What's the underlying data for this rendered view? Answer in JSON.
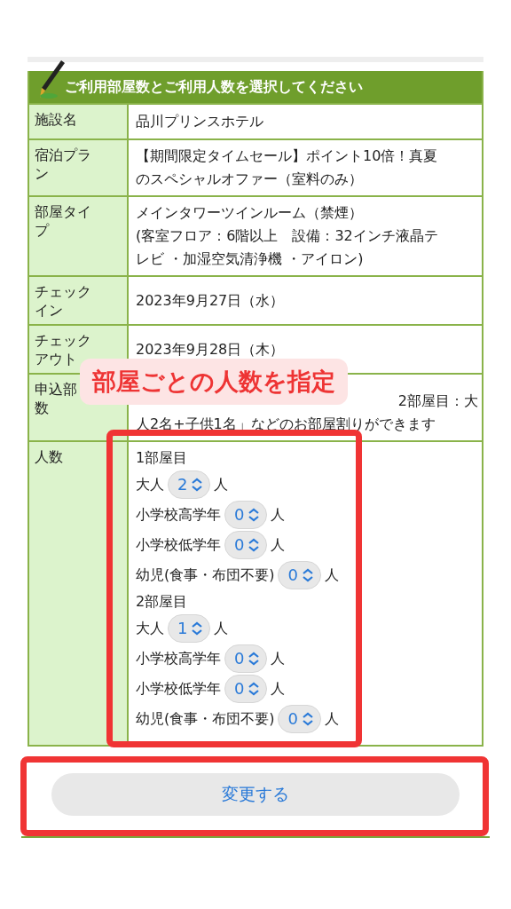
{
  "header": {
    "title": "ご利用部屋数とご利用人数を選択してください"
  },
  "rows": [
    {
      "label": [
        "施設名"
      ],
      "value": [
        "品川プリンスホテル"
      ]
    },
    {
      "label": [
        "宿泊プラ",
        "ン"
      ],
      "value": [
        "【期間限定タイムセール】ポイント10倍！真夏",
        "のスペシャルオファー（室料のみ）"
      ]
    },
    {
      "label": [
        "部屋タイ",
        "プ"
      ],
      "value": [
        "メインタワーツインルーム（禁煙）",
        "(客室フロア：6階以上　設備：32インチ液晶テ",
        "レビ ・加湿空気清浄機 ・アイロン)"
      ]
    },
    {
      "label": [
        "チェック",
        "イン"
      ],
      "value": [
        "2023年9月27日（水）"
      ]
    },
    {
      "label": [
        "チェック",
        "アウト"
      ],
      "value": [
        "2023年9月28日（木）"
      ]
    }
  ],
  "rooms_row": {
    "label": [
      "申込部",
      "数"
    ],
    "value_tail": "2部屋目：大",
    "value": "人2名+子供1名」などのお部屋割りができます"
  },
  "people": {
    "label": "人数",
    "rooms": [
      {
        "title": "1部屋目",
        "counts": [
          {
            "label": "大人",
            "value": "2",
            "unit": "人"
          },
          {
            "label": "小学校高学年",
            "value": "0",
            "unit": "人"
          },
          {
            "label": "小学校低学年",
            "value": "0",
            "unit": "人"
          },
          {
            "label": "幼児(食事・布団不要)",
            "value": "0",
            "unit": "人"
          }
        ]
      },
      {
        "title": "2部屋目",
        "counts": [
          {
            "label": "大人",
            "value": "1",
            "unit": "人"
          },
          {
            "label": "小学校高学年",
            "value": "0",
            "unit": "人"
          },
          {
            "label": "小学校低学年",
            "value": "0",
            "unit": "人"
          },
          {
            "label": "幼児(食事・布団不要)",
            "value": "0",
            "unit": "人"
          }
        ]
      }
    ]
  },
  "submit": {
    "label": "変更する"
  },
  "annotation": {
    "text": "部屋ごとの人数を指定"
  }
}
